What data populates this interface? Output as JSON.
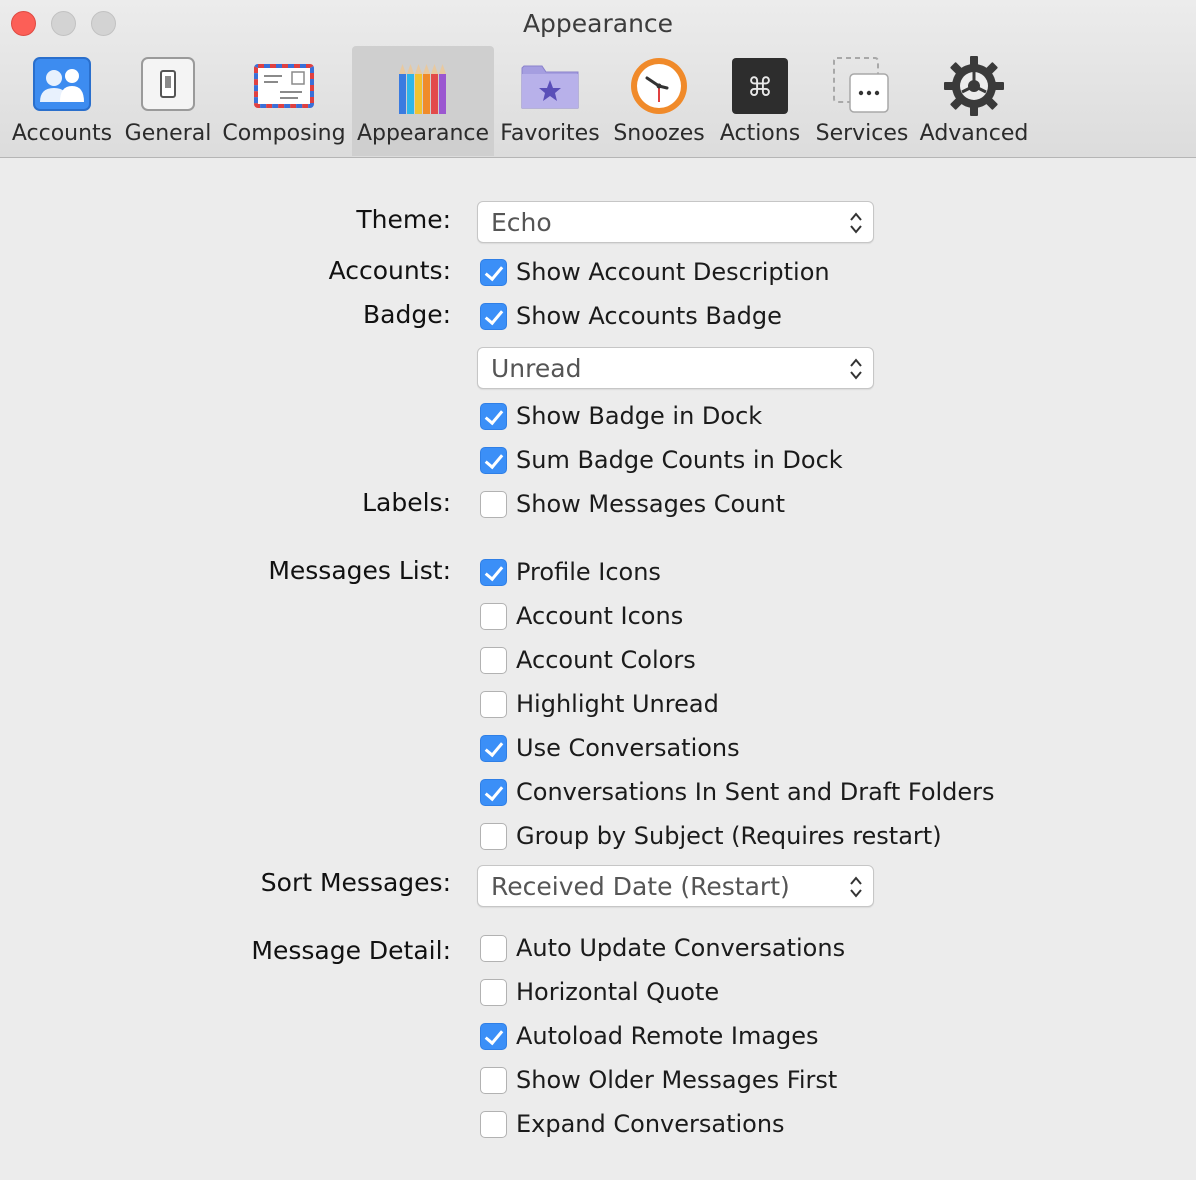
{
  "window": {
    "title": "Appearance"
  },
  "toolbar": {
    "tabs": [
      {
        "label": "Accounts"
      },
      {
        "label": "General"
      },
      {
        "label": "Composing"
      },
      {
        "label": "Appearance",
        "selected": true
      },
      {
        "label": "Favorites"
      },
      {
        "label": "Snoozes"
      },
      {
        "label": "Actions"
      },
      {
        "label": "Services"
      },
      {
        "label": "Advanced"
      }
    ]
  },
  "form": {
    "theme": {
      "label": "Theme:",
      "value": "Echo"
    },
    "accounts": {
      "label": "Accounts:",
      "show_description": {
        "text": "Show Account Description",
        "checked": true
      }
    },
    "badge": {
      "label": "Badge:",
      "show_accounts_badge": {
        "text": "Show Accounts Badge",
        "checked": true
      },
      "badge_type": {
        "value": "Unread"
      },
      "show_badge_in_dock": {
        "text": "Show Badge in Dock",
        "checked": true
      },
      "sum_badge_counts": {
        "text": "Sum Badge Counts in Dock",
        "checked": true
      }
    },
    "labels": {
      "label": "Labels:",
      "show_messages_count": {
        "text": "Show Messages Count",
        "checked": false
      }
    },
    "messages_list": {
      "label": "Messages List:",
      "options": [
        {
          "text": "Profile Icons",
          "checked": true
        },
        {
          "text": "Account Icons",
          "checked": false
        },
        {
          "text": "Account Colors",
          "checked": false
        },
        {
          "text": "Highlight Unread",
          "checked": false
        },
        {
          "text": "Use Conversations",
          "checked": true
        },
        {
          "text": "Conversations In Sent and Draft Folders",
          "checked": true
        },
        {
          "text": "Group by Subject (Requires restart)",
          "checked": false
        }
      ]
    },
    "sort_messages": {
      "label": "Sort Messages:",
      "value": "Received Date (Restart)"
    },
    "message_detail": {
      "label": "Message Detail:",
      "options": [
        {
          "text": "Auto Update Conversations",
          "checked": false
        },
        {
          "text": "Horizontal Quote",
          "checked": false
        },
        {
          "text": "Autoload Remote Images",
          "checked": true
        },
        {
          "text": "Show Older Messages First",
          "checked": false
        },
        {
          "text": "Expand Conversations",
          "checked": false
        }
      ]
    }
  },
  "colors": {
    "accent": "#3b8ff7",
    "close_button": "#fc5f57"
  },
  "icons": [
    "accounts-icon",
    "general-icon",
    "composing-icon",
    "appearance-icon",
    "favorites-icon",
    "snoozes-icon",
    "actions-icon",
    "services-icon",
    "advanced-icon",
    "stepper-arrows-icon",
    "checkmark-icon"
  ]
}
